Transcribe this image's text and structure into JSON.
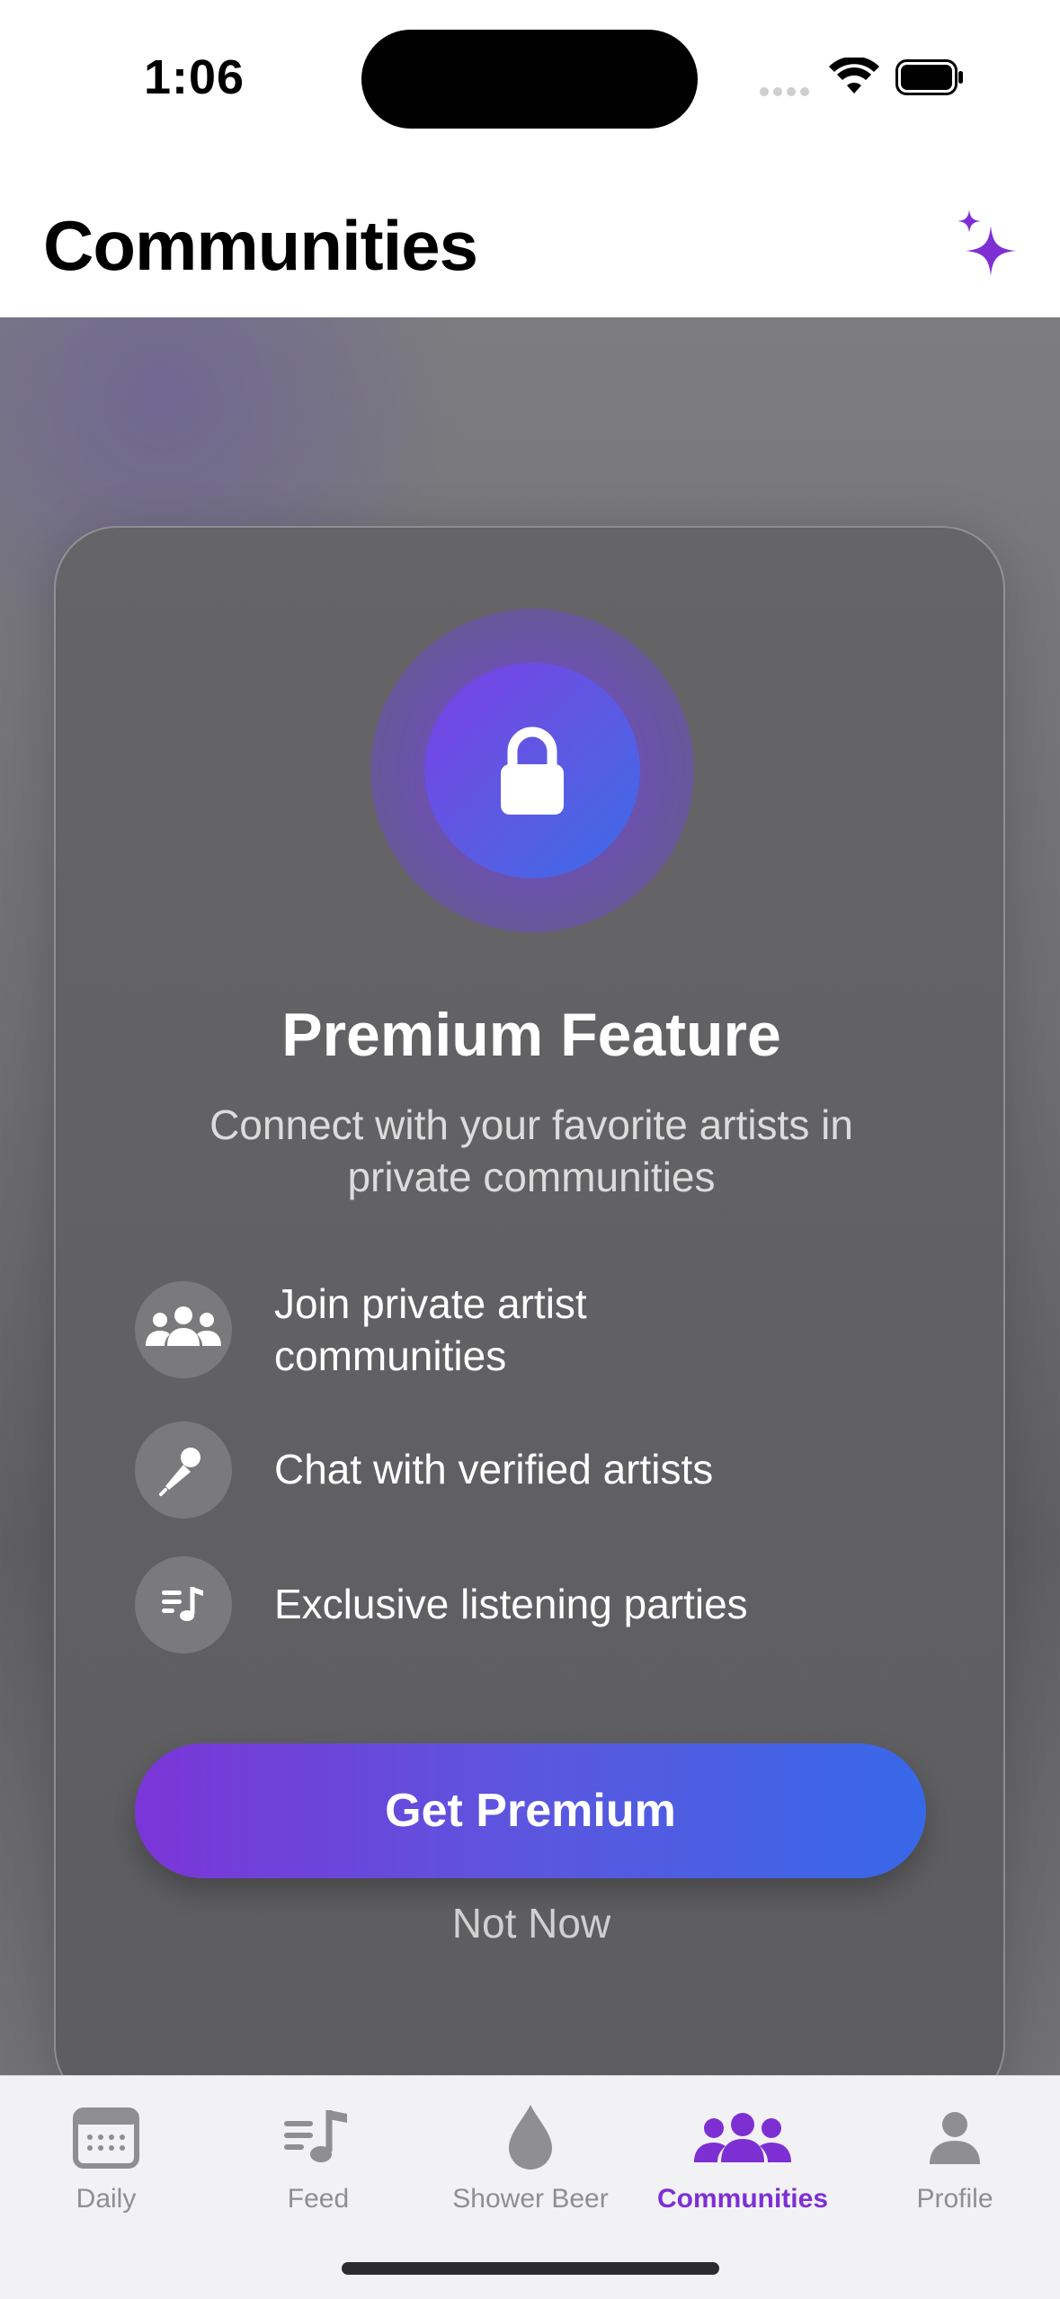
{
  "status_bar": {
    "time": "1:06"
  },
  "header": {
    "title": "Communities"
  },
  "premium": {
    "title": "Premium Feature",
    "subtitle": "Connect with your favorite artists in private communities",
    "features": [
      {
        "icon": "people-icon",
        "text": "Join private artist communities"
      },
      {
        "icon": "microphone-icon",
        "text": "Chat with verified artists"
      },
      {
        "icon": "music-list-icon",
        "text": "Exclusive listening parties"
      }
    ],
    "cta_label": "Get Premium",
    "dismiss_label": "Not Now"
  },
  "tabs": [
    {
      "label": "Daily",
      "icon": "calendar-icon",
      "active": false
    },
    {
      "label": "Feed",
      "icon": "music-list-icon",
      "active": false
    },
    {
      "label": "Shower Beer",
      "icon": "drop-icon",
      "active": false
    },
    {
      "label": "Communities",
      "icon": "people-icon",
      "active": true
    },
    {
      "label": "Profile",
      "icon": "person-icon",
      "active": false
    }
  ],
  "colors": {
    "accent": "#7e2fd4",
    "gradient_start": "#7b35d8",
    "gradient_end": "#3868e8",
    "tab_inactive": "#8e8e93"
  }
}
